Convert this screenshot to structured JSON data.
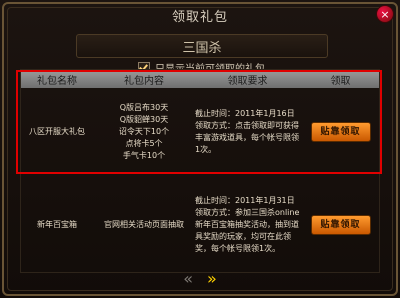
{
  "window": {
    "title": "领取礼包"
  },
  "game": {
    "title": "三国杀"
  },
  "filter": {
    "label": "只显示当前可领取的礼包"
  },
  "table": {
    "headers": [
      "礼包名称",
      "礼包内容",
      "领取要求",
      "领取"
    ],
    "rows": [
      {
        "name": "八区开服大礼包",
        "contents": [
          "Q版吕布30天",
          "Q版貂蝉30天",
          "诏令天下10个",
          "点将卡5个",
          "手气卡10个"
        ],
        "requirements": "截止时间：2011年1月16日\n领取方式：点击领取即可获得丰富游戏道具，每个帐号限领1次。",
        "button": "贴靠领取"
      },
      {
        "name": "新年百宝箱",
        "contents": [
          "官网相关活动页面抽取"
        ],
        "requirements": "截止时间：2011年1月31日\n领取方式：参加三国杀online新年百宝箱抽奖活动，抽到道具奖励的玩家，均可在此领奖，每个帐号限领1次。",
        "button": "贴靠领取"
      }
    ]
  },
  "icons": {
    "close": "close-icon",
    "prev": "chevron-left-icon",
    "next": "chevron-right-icon"
  },
  "colors": {
    "highlight": "#e00000",
    "button": "#ff9b2f"
  }
}
